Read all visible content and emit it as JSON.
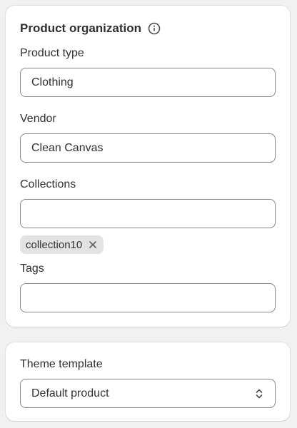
{
  "product_organization": {
    "title": "Product organization",
    "product_type": {
      "label": "Product type",
      "value": "Clothing"
    },
    "vendor": {
      "label": "Vendor",
      "value": "Clean Canvas"
    },
    "collections": {
      "label": "Collections",
      "value": "",
      "selected": [
        "collection10"
      ]
    },
    "tags": {
      "label": "Tags",
      "value": ""
    }
  },
  "theme_template": {
    "label": "Theme template",
    "selected": "Default product"
  },
  "icons": {
    "info": "info-icon",
    "remove": "close-icon",
    "select": "chevron-up-down-icon"
  }
}
